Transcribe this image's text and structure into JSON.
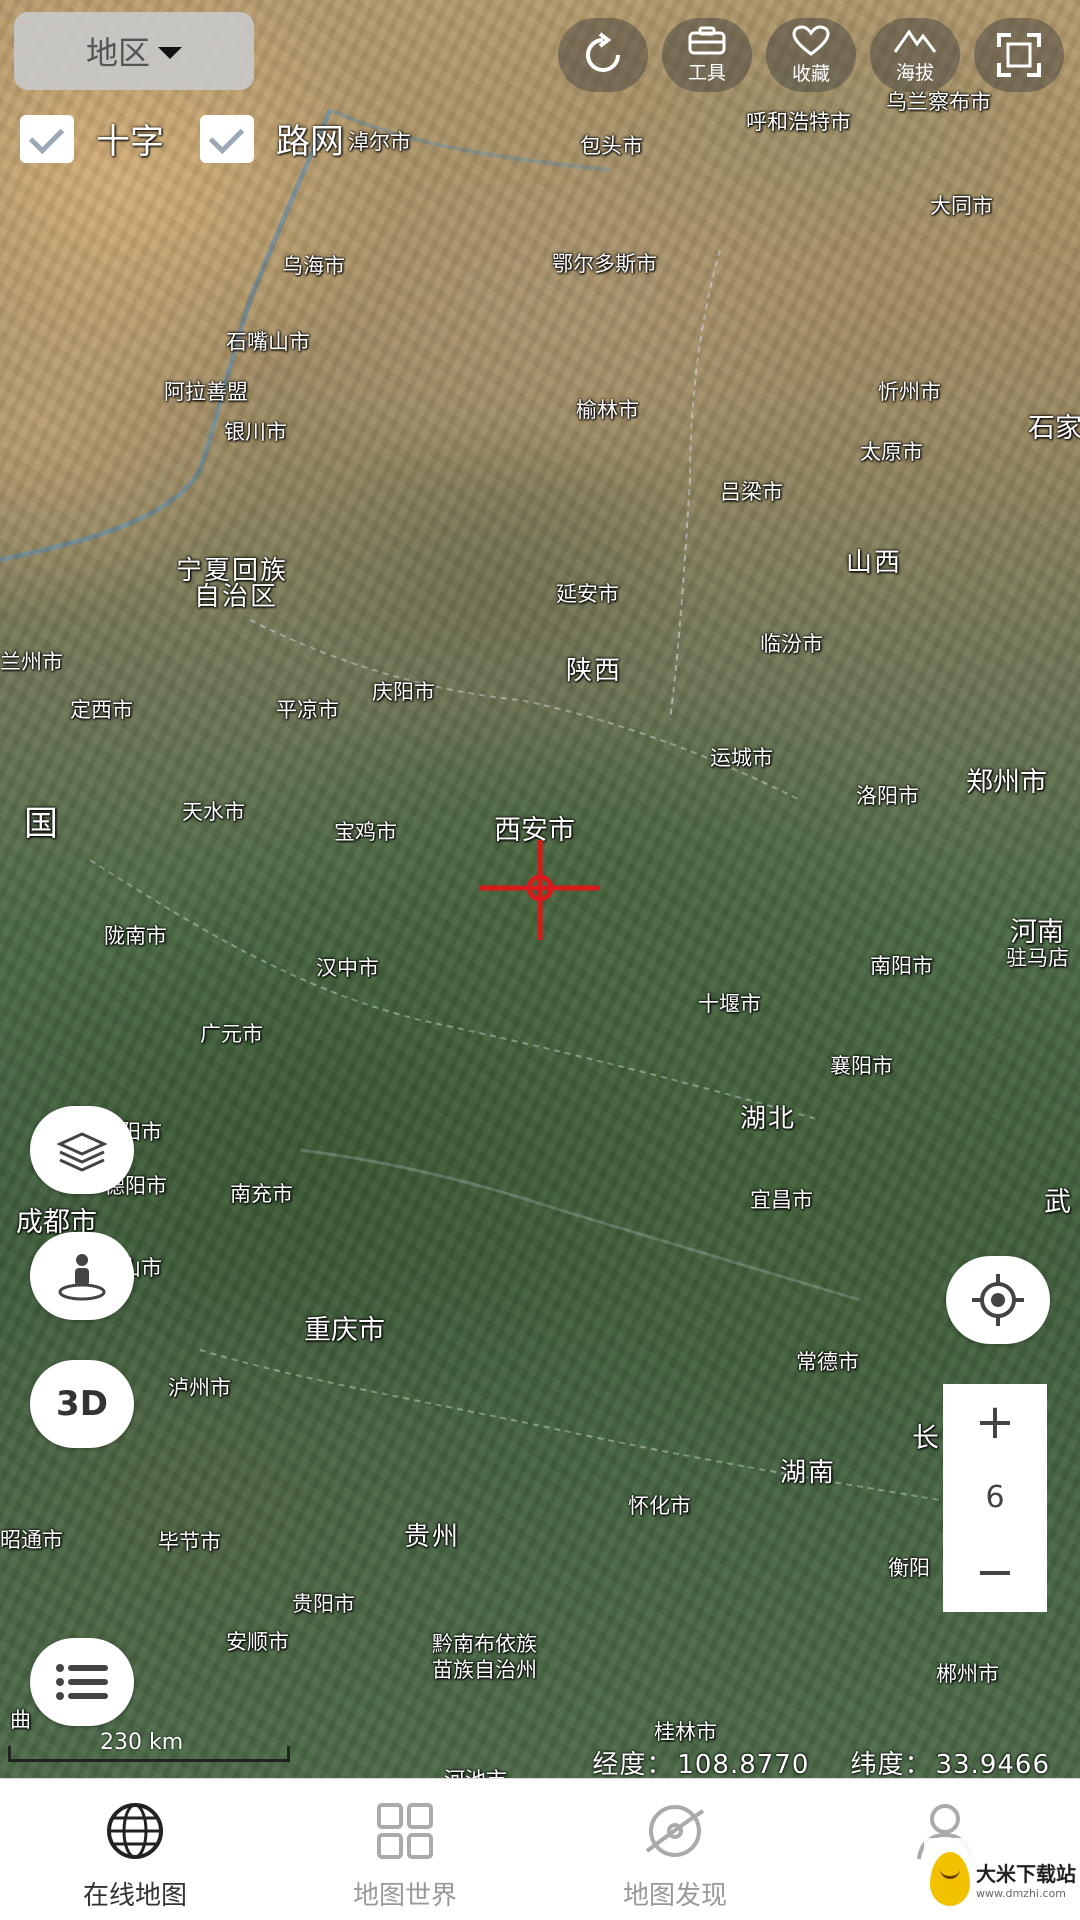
{
  "header": {
    "region_label": "地区",
    "cross_label": "十字",
    "roads_label": "路网",
    "tools": [
      {
        "name": "refresh",
        "label": ""
      },
      {
        "name": "tools",
        "label": "工具"
      },
      {
        "name": "favorites",
        "label": "收藏"
      },
      {
        "name": "elevation",
        "label": "海拔"
      },
      {
        "name": "fullscreen",
        "label": ""
      }
    ]
  },
  "map": {
    "labels": [
      "淖尔市",
      "包头市",
      "呼和浩特市",
      "乌兰察布市",
      "大同市",
      "乌海市",
      "鄂尔多斯市",
      "石嘴山市",
      "阿拉善盟",
      "银川市",
      "榆林市",
      "忻州市",
      "石家",
      "太原市",
      "吕梁市",
      "宁夏回族",
      "自治区",
      "山西",
      "延安市",
      "兰州市",
      "陕西",
      "临汾市",
      "定西市",
      "平凉市",
      "庆阳市",
      "运城市",
      "郑州市",
      "洛阳市",
      "国",
      "天水市",
      "宝鸡市",
      "西安市",
      "河南",
      "驻马店",
      "陇南市",
      "汉中市",
      "南阳市",
      "十堰市",
      "广元市",
      "襄阳市",
      "湖北",
      "阳市",
      "德阳市",
      "南充市",
      "宜昌市",
      "武",
      "成都市",
      "山市",
      "重庆市",
      "常德市",
      "泸州市",
      "长",
      "湖南",
      "昭通市",
      "毕节市",
      "贵州",
      "怀化市",
      "衡阳",
      "贵阳市",
      "安顺市",
      "黔南布依族",
      "苗族自治州",
      "郴州市",
      "曲",
      "桂林市",
      "河池市"
    ]
  },
  "controls": {
    "three_d_label": "3D",
    "zoom_in": "+",
    "zoom_level": "6",
    "zoom_out": "−"
  },
  "status": {
    "scale": "230 km",
    "lon_label": "经度：",
    "lon_value": "108.8770",
    "lat_label": "纬度：",
    "lat_value": "33.9466"
  },
  "nav": {
    "items": [
      {
        "label": "在线地图",
        "icon": "globe-icon",
        "active": true
      },
      {
        "label": "地图世界",
        "icon": "grid-icon",
        "active": false
      },
      {
        "label": "地图发现",
        "icon": "compass-icon",
        "active": false
      },
      {
        "label": "个",
        "icon": "person-icon",
        "active": false
      }
    ]
  },
  "watermark": {
    "title": "大米下载站",
    "url": "www.dmzhi.com"
  },
  "colors": {
    "crosshair": "#d41c1c",
    "nav_active": "#333333",
    "nav_inactive": "#999999"
  }
}
